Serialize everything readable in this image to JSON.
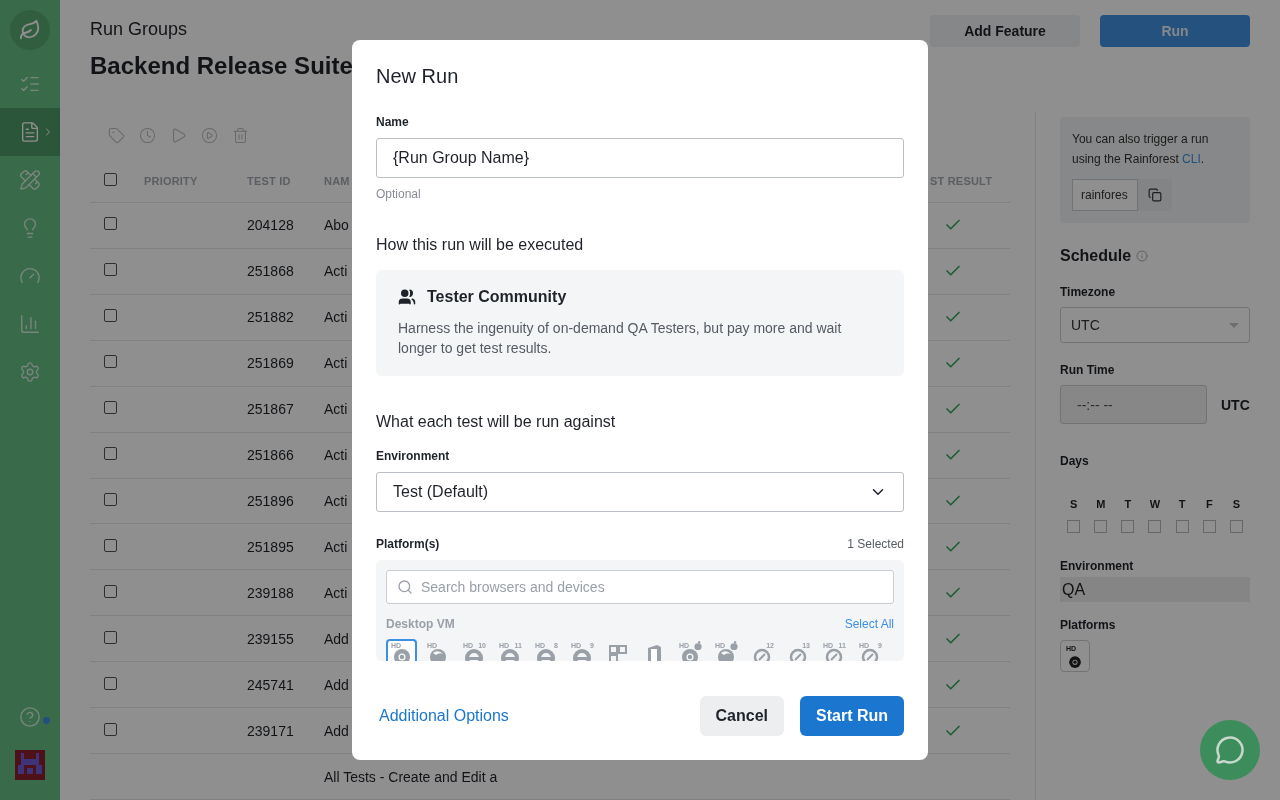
{
  "sidebar": {
    "nav": [
      {
        "kind": "checklist",
        "selected": false
      },
      {
        "kind": "document",
        "selected": true
      },
      {
        "kind": "tools",
        "selected": false
      },
      {
        "kind": "bulb",
        "selected": false
      },
      {
        "kind": "gauge",
        "selected": false
      },
      {
        "kind": "chart",
        "selected": false
      },
      {
        "kind": "gear",
        "selected": false
      }
    ],
    "help_notification": true
  },
  "header": {
    "breadcrumb": "Run Groups",
    "title": "Backend Release Suite",
    "buttons": [
      {
        "label": "Add Feature",
        "kind": "secondary"
      },
      {
        "label": "Run",
        "kind": "primary"
      }
    ]
  },
  "toolbar": [
    {
      "kind": "tag"
    },
    {
      "kind": "clock"
    },
    {
      "kind": "play"
    },
    {
      "kind": "play-circle"
    },
    {
      "kind": "trash"
    }
  ],
  "table": {
    "select_all": {
      "checked": false
    },
    "columns": [
      "PRIORITY",
      "TEST ID",
      "NAM",
      "ST RESULT"
    ],
    "rows": [
      {
        "checked": false,
        "test_id": "204128",
        "name": "Abo",
        "passed": true
      },
      {
        "checked": false,
        "test_id": "251868",
        "name": "Acti",
        "passed": true
      },
      {
        "checked": false,
        "test_id": "251882",
        "name": "Acti",
        "passed": true
      },
      {
        "checked": false,
        "test_id": "251869",
        "name": "Acti",
        "passed": true
      },
      {
        "checked": false,
        "test_id": "251867",
        "name": "Acti",
        "passed": true
      },
      {
        "checked": false,
        "test_id": "251866",
        "name": "Acti",
        "passed": true
      },
      {
        "checked": false,
        "test_id": "251896",
        "name": "Acti",
        "passed": true
      },
      {
        "checked": false,
        "test_id": "251895",
        "name": "Acti",
        "passed": true
      },
      {
        "checked": false,
        "test_id": "239188",
        "name": "Acti",
        "passed": true
      },
      {
        "checked": false,
        "test_id": "239155",
        "name": "Add",
        "passed": true
      },
      {
        "checked": false,
        "test_id": "245741",
        "name": "Add",
        "passed": true
      },
      {
        "checked": false,
        "test_id": "239171",
        "name": "Add",
        "passed": true
      },
      {
        "name": "All Tests - Create and Edit a"
      }
    ]
  },
  "right_panel": {
    "cli": {
      "text_before": "You can also trigger a run using the Rainforest ",
      "link": "CLI",
      "text_after": ".",
      "command": "rainfores"
    },
    "schedule": {
      "title": "Schedule",
      "timezone_label": "Timezone",
      "timezone": "UTC",
      "run_time_label": "Run Time",
      "run_time_placeholder": "--:-- --",
      "run_time_zone": "UTC",
      "days_label": "Days",
      "days": [
        {
          "label": "S",
          "checked": false
        },
        {
          "label": "M",
          "checked": false
        },
        {
          "label": "T",
          "checked": false
        },
        {
          "label": "W",
          "checked": false
        },
        {
          "label": "T",
          "checked": false
        },
        {
          "label": "F",
          "checked": false
        },
        {
          "label": "S",
          "checked": false
        }
      ],
      "environment_label": "Environment",
      "environment": "QA",
      "platforms_label": "Platforms",
      "platforms": [
        {
          "badge": "HD",
          "kind": "chrome"
        }
      ]
    }
  },
  "modal": {
    "title": "New Run",
    "name_label": "Name",
    "name_value": "{Run Group Name}",
    "name_hint": "Optional",
    "execution_heading": "How this run will be executed",
    "execution": {
      "title": "Tester Community",
      "description": "Harness the ingenuity of on-demand QA Testers, but pay more and wait longer to get test results."
    },
    "target_heading": "What each test will be run against",
    "environment_label": "Environment",
    "environment": "Test (Default)",
    "platforms_label": "Platform(s)",
    "platforms_count": "1 Selected",
    "search_placeholder": "Search browsers and devices",
    "group": {
      "title": "Desktop VM",
      "action": "Select All",
      "platforms": [
        {
          "badge": "HD",
          "kind": "chrome",
          "selected": true
        },
        {
          "badge": "HD",
          "kind": "firefox",
          "selected": false
        },
        {
          "badge": "HD",
          "version": "10",
          "kind": "ie",
          "selected": false
        },
        {
          "badge": "HD",
          "version": "11",
          "kind": "ie",
          "selected": false
        },
        {
          "badge": "HD",
          "version": "8",
          "kind": "ie",
          "selected": false
        },
        {
          "badge": "HD",
          "version": "9",
          "kind": "ie",
          "selected": false
        },
        {
          "kind": "tiles",
          "selected": false
        },
        {
          "kind": "office",
          "selected": false
        },
        {
          "badge": "HD",
          "mac": true,
          "kind": "chrome",
          "selected": false
        },
        {
          "badge": "HD",
          "mac": true,
          "kind": "firefox",
          "selected": false
        },
        {
          "version": "12",
          "kind": "safari",
          "selected": false
        },
        {
          "version": "13",
          "kind": "safari",
          "selected": false
        },
        {
          "badge": "HD",
          "version": "11",
          "kind": "safari",
          "selected": false
        },
        {
          "badge": "HD",
          "version": "9",
          "kind": "safari",
          "selected": false
        }
      ]
    },
    "footer": {
      "link": "Additional Options",
      "buttons": [
        {
          "label": "Cancel",
          "kind": "secondary"
        },
        {
          "label": "Start Run",
          "kind": "primary"
        }
      ]
    }
  }
}
